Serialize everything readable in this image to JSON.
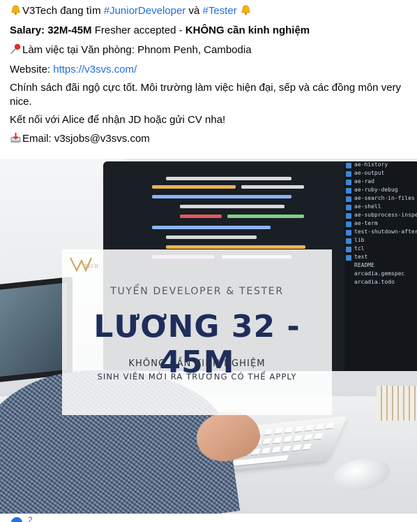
{
  "post": {
    "line1": {
      "prefix": "V3Tech đang tìm ",
      "hashtag1": "#JuniorDeveloper",
      "middle": " và ",
      "hashtag2": "#Tester",
      "bell_icon": "bell-icon"
    },
    "line2": {
      "salary_label": "Salary: 32M-45M",
      "middle": " Fresher accepted - ",
      "no_experience": "KHÔNG cần kinh nghiệm"
    },
    "line3": {
      "pin_icon": "pushpin-icon",
      "text": "Làm việc tại Văn phòng: Phnom Penh, Cambodia"
    },
    "line4": {
      "label": "Website: ",
      "url": "https://v3svs.com/"
    },
    "line5": {
      "text": "Chính sách đãi ngộ cực tốt. Môi trường làm việc hiện đại, sếp và các đồng môn very nice."
    },
    "line6": {
      "text": "Kết nối với Alice để nhận JD hoặc gửi CV nha!"
    },
    "line7": {
      "mail_icon": "inbox-tray-icon",
      "text": "Email: v3sjobs@v3svs.com"
    }
  },
  "image": {
    "logo_text": "TECH",
    "subtitle": "TUYỂN DEVELOPER & TESTER",
    "headline": "LƯƠNG 32 - 45M",
    "note1": "KHÔNG CẦN KINH NGHIỆM",
    "note2": "SINH VIÊN MỚI RA TRƯỜNG CÓ THỂ APPLY",
    "tree_items": [
      "ae-history",
      "ae-output",
      "ae-rad",
      "ae-ruby-debug",
      "ae-search-in-files",
      "ae-shell",
      "ae-subprocess-inspect",
      "ae-term",
      "test-shutdown-after",
      "lib",
      "tcl",
      "test",
      "README",
      "arcadia.gemspec",
      "arcadia.todo"
    ]
  },
  "colors": {
    "link": "#216fdb",
    "headline": "#1f2d5c",
    "text": "#050505"
  },
  "footer": {
    "reaction_count": "2"
  }
}
